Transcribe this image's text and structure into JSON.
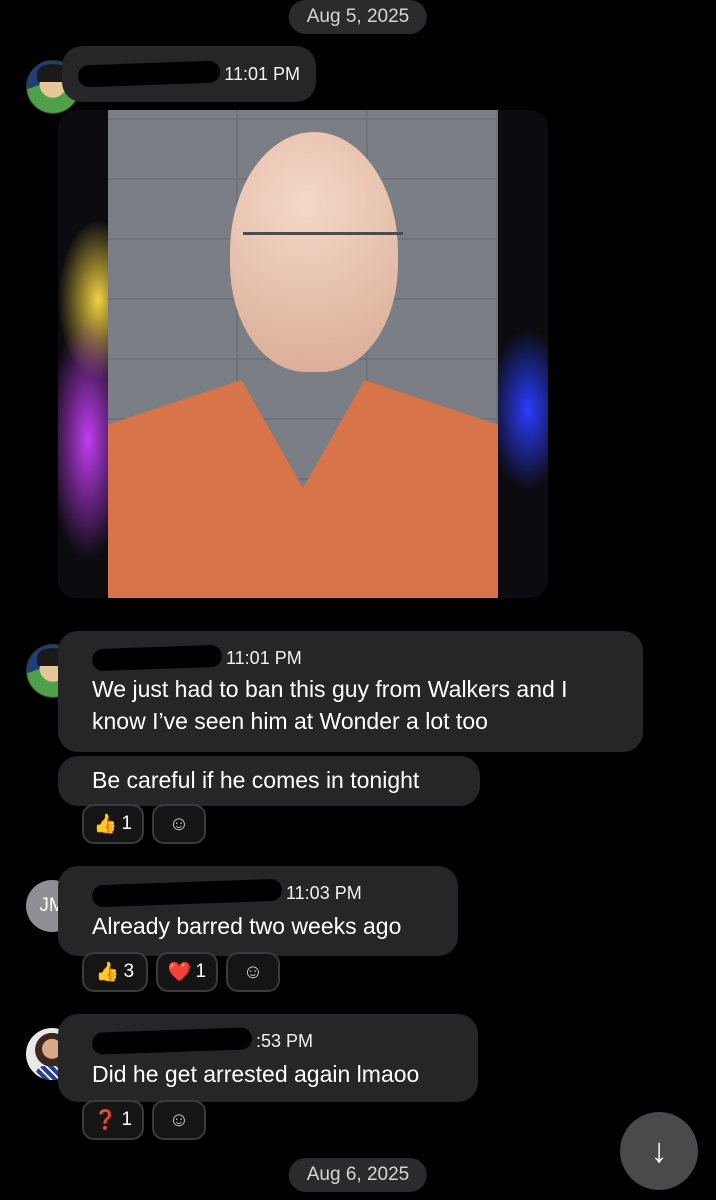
{
  "dates": {
    "first": "Aug 5, 2025",
    "second": "Aug 6, 2025"
  },
  "messages": [
    {
      "time": "11:01 PM"
    },
    {
      "time": "11:01 PM",
      "text_1": "We just had to ban this guy from Walkers and I know I’ve seen him at Wonder a lot too",
      "text_2": "Be careful if he comes in tonight",
      "reactions": [
        {
          "emoji": "👍",
          "count": "1"
        }
      ]
    },
    {
      "initials": "JM",
      "time": "11:03 PM",
      "text": "Already barred two weeks ago",
      "reactions": [
        {
          "emoji": "👍",
          "count": "3"
        },
        {
          "emoji": "❤️",
          "count": "1"
        }
      ]
    },
    {
      "time": ":53 PM",
      "text": "Did he get arrested again lmaoo",
      "reactions": [
        {
          "emoji": "❓",
          "count": "1"
        }
      ]
    }
  ],
  "icons": {
    "add_reaction": "add-reaction-icon",
    "scroll_down": "arrow-down-icon"
  }
}
